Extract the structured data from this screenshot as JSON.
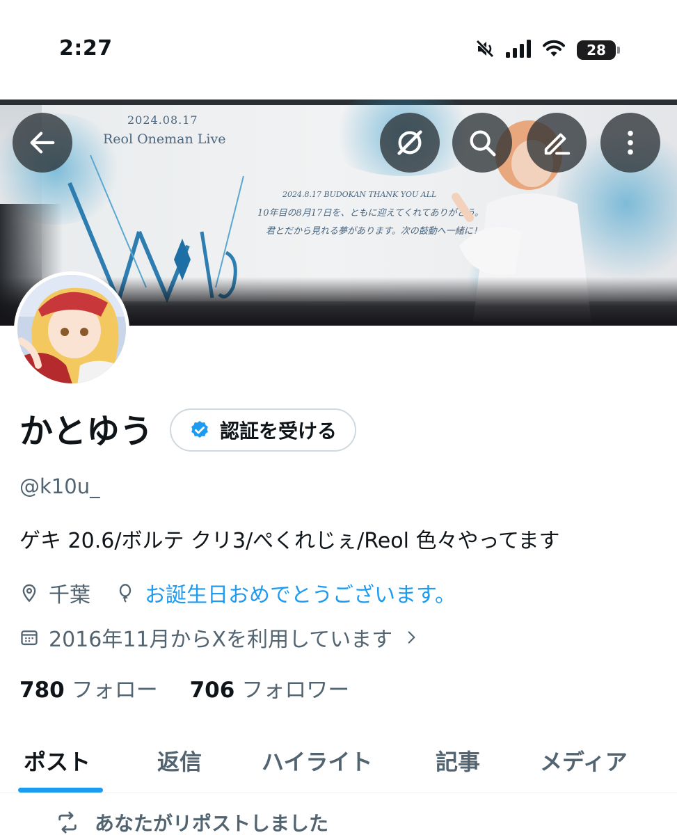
{
  "status_bar": {
    "time": "2:27",
    "battery_level": "28",
    "icons": [
      "mute-icon",
      "cellular-signal-icon",
      "wifi-icon",
      "battery-icon"
    ]
  },
  "banner": {
    "date_text": "2024.08.17",
    "live_text": "Reol Oneman Live",
    "script_line_1": "2024.8.17 BUDOKAN THANK YOU ALL",
    "script_line_2": "10年目の8月17日を、ともに迎えてくれてありがとう。",
    "script_line_3": "君とだから見れる夢があります。次の鼓動へ一緒に！",
    "logo_text": "Wa ti!e"
  },
  "header_actions": {
    "back": "back-arrow-icon",
    "grok": "grok-icon",
    "search": "search-icon",
    "edit": "edit-icon",
    "more": "more-icon"
  },
  "profile": {
    "display_name": "かとゆう",
    "verify_label": "認証を受ける",
    "handle": "@k10u_",
    "bio": "ゲキ 20.6/ボルテ クリ3/ぺくれじぇ/Reol 色々やってます",
    "location": "千葉",
    "birthday": "お誕生日おめでとうございます。",
    "joined": "2016年11月からXを利用しています",
    "following_count": "780",
    "following_label": "フォロー",
    "followers_count": "706",
    "followers_label": "フォロワー"
  },
  "tabs": {
    "posts": "ポスト",
    "replies": "返信",
    "highlights": "ハイライト",
    "articles": "記事",
    "media": "メディア",
    "active": "posts"
  },
  "feed": {
    "repost_label": "あなたがリポストしました"
  },
  "colors": {
    "accent": "#1d9bf0",
    "text_primary": "#0f1419",
    "text_secondary": "#536471",
    "button_overlay": "#272c30"
  }
}
